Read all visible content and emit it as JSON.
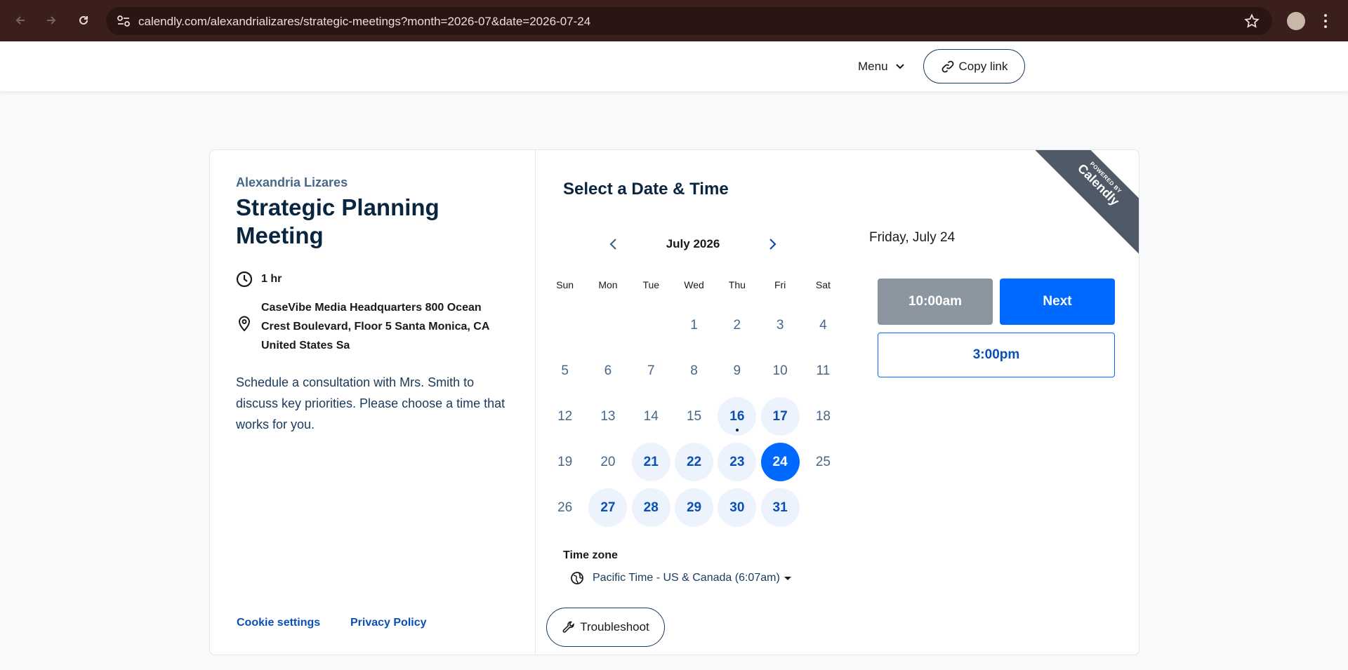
{
  "browser": {
    "url": "calendly.com/alexandrializares/strategic-meetings?month=2026-07&date=2026-07-24"
  },
  "header": {
    "menu_label": "Menu",
    "copy_link_label": "Copy link"
  },
  "event": {
    "host": "Alexandria Lizares",
    "title": "Strategic Planning Meeting",
    "duration": "1 hr",
    "location": "CaseVibe Media Headquarters 800 Ocean Crest Boulevard, Floor 5 Santa Monica, CA United States Sa",
    "description": "Schedule a consultation with Mrs. Smith to discuss key priorities. Please choose a time that works for you."
  },
  "footer": {
    "cookie_settings": "Cookie settings",
    "privacy_policy": "Privacy Policy"
  },
  "scheduler": {
    "title": "Select a Date & Time",
    "ribbon_small": "POWERED BY",
    "ribbon_brand": "Calendly",
    "month_label": "July 2026",
    "weekdays": [
      "Sun",
      "Mon",
      "Tue",
      "Wed",
      "Thu",
      "Fri",
      "Sat"
    ],
    "days": [
      {
        "label": "",
        "state": "empty"
      },
      {
        "label": "",
        "state": "empty"
      },
      {
        "label": "",
        "state": "empty"
      },
      {
        "label": "1",
        "state": "unavailable"
      },
      {
        "label": "2",
        "state": "unavailable"
      },
      {
        "label": "3",
        "state": "unavailable"
      },
      {
        "label": "4",
        "state": "unavailable"
      },
      {
        "label": "5",
        "state": "unavailable"
      },
      {
        "label": "6",
        "state": "unavailable"
      },
      {
        "label": "7",
        "state": "unavailable"
      },
      {
        "label": "8",
        "state": "unavailable"
      },
      {
        "label": "9",
        "state": "unavailable"
      },
      {
        "label": "10",
        "state": "unavailable"
      },
      {
        "label": "11",
        "state": "unavailable"
      },
      {
        "label": "12",
        "state": "unavailable"
      },
      {
        "label": "13",
        "state": "unavailable"
      },
      {
        "label": "14",
        "state": "unavailable"
      },
      {
        "label": "15",
        "state": "unavailable"
      },
      {
        "label": "16",
        "state": "available",
        "today": true
      },
      {
        "label": "17",
        "state": "available"
      },
      {
        "label": "18",
        "state": "unavailable"
      },
      {
        "label": "19",
        "state": "unavailable"
      },
      {
        "label": "20",
        "state": "unavailable"
      },
      {
        "label": "21",
        "state": "available"
      },
      {
        "label": "22",
        "state": "available"
      },
      {
        "label": "23",
        "state": "available"
      },
      {
        "label": "24",
        "state": "selected"
      },
      {
        "label": "25",
        "state": "unavailable"
      },
      {
        "label": "26",
        "state": "unavailable"
      },
      {
        "label": "27",
        "state": "available"
      },
      {
        "label": "28",
        "state": "available"
      },
      {
        "label": "29",
        "state": "available"
      },
      {
        "label": "30",
        "state": "available"
      },
      {
        "label": "31",
        "state": "available"
      }
    ],
    "timezone_label": "Time zone",
    "timezone_value": "Pacific Time - US & Canada (6:07am)",
    "troubleshoot_label": "Troubleshoot",
    "selected_date": "Friday, July 24",
    "selected_time": "10:00am",
    "next_label": "Next",
    "other_times": [
      "3:00pm"
    ]
  },
  "colors": {
    "accent": "#0069ff",
    "selected_slot_bg": "#8b96a1",
    "available_day_bg": "#ecf3fd",
    "chrome_bg": "#3b1f1c"
  }
}
